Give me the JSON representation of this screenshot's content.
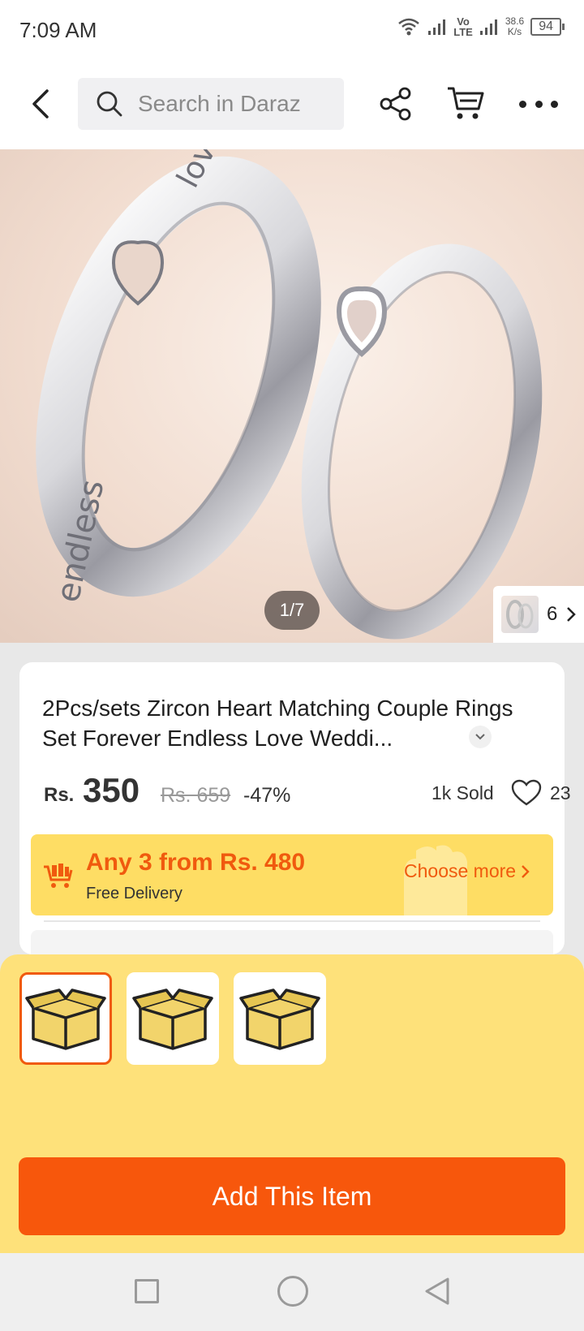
{
  "status_bar": {
    "time": "7:09 AM",
    "network_line1": "Vo",
    "network_line2": "LTE",
    "speed_value": "38.6",
    "speed_unit": "K/s",
    "battery": "94"
  },
  "header": {
    "search_placeholder": "Search in Daraz",
    "icons": [
      "back-arrow-icon",
      "search-icon",
      "share-icon",
      "cart-icon",
      "more-icon"
    ]
  },
  "gallery": {
    "pager": "1/7",
    "variant_count": "6",
    "image_text": [
      "endless",
      "love"
    ]
  },
  "product": {
    "title": "2Pcs/sets Zircon Heart Matching Couple Rings Set Forever Endless Love Weddi...",
    "currency": "Rs.",
    "price": "350",
    "original_price": "Rs. 659",
    "discount": "-47%",
    "sold": "1k Sold",
    "likes": "23"
  },
  "promo": {
    "title": "Any 3 from Rs. 480",
    "subtitle": "Free Delivery",
    "link": "Choose more",
    "colors": {
      "background": "#fedd64",
      "accent": "#f05a0e"
    }
  },
  "sheet": {
    "thumbnails": [
      "box-icon",
      "box-icon",
      "box-icon"
    ],
    "selected_index": 0,
    "button_label": "Add This Item",
    "colors": {
      "background": "#fee17a",
      "button": "#f7570c"
    }
  }
}
